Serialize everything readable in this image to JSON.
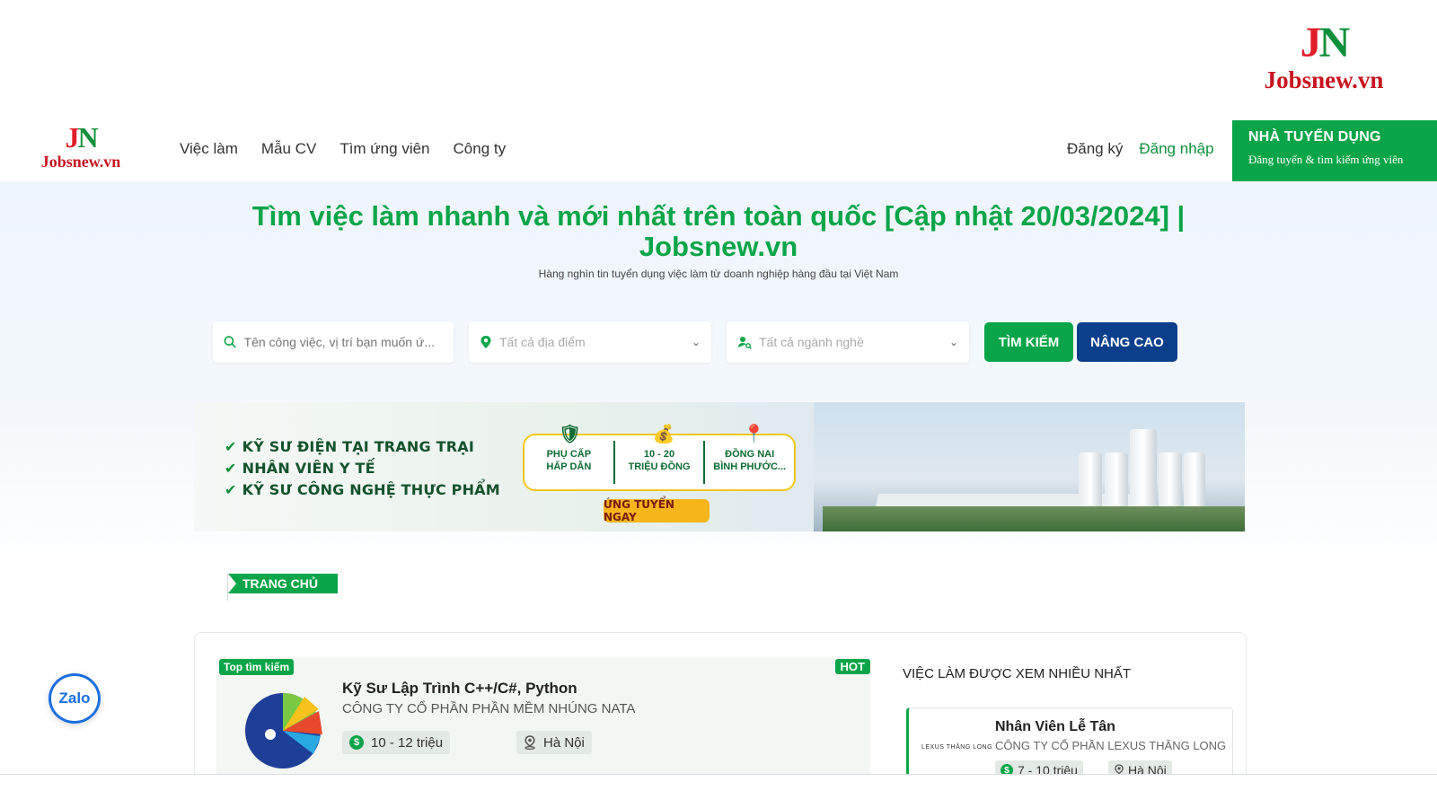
{
  "brand": {
    "mark_j": "J",
    "mark_n": "N",
    "name": "Jobsnew.vn"
  },
  "nav": {
    "items": [
      "Việc làm",
      "Mẫu CV",
      "Tìm ứng viên",
      "Công ty"
    ]
  },
  "auth": {
    "register": "Đăng ký",
    "login": "Đăng nhập"
  },
  "employer": {
    "title": "NHÀ TUYỂN DỤNG",
    "subtitle": "Đăng tuyển & tìm kiếm ứng viên"
  },
  "hero": {
    "title": "Tìm việc làm nhanh và mới nhất trên toàn quốc [Cập nhật 20/03/2024] | Jobsnew.vn",
    "subtitle": "Hàng nghìn tin tuyển dụng việc làm từ doanh nghiệp hàng đầu tại Việt Nam"
  },
  "search": {
    "keyword_placeholder": "Tên công việc, vị trí bạn muốn ứ...",
    "location_placeholder": "Tất cả địa điểm",
    "industry_placeholder": "Tất cả ngành nghề",
    "search_label": "TÌM KIẾM",
    "advanced_label": "NÂNG CAO"
  },
  "banner": {
    "items": [
      "KỸ SƯ ĐIỆN TẠI TRANG TRẠI",
      "NHÂN VIÊN Y TẾ",
      "KỸ SƯ CÔNG NGHỆ THỰC PHẨM"
    ],
    "perks": [
      {
        "l1": "PHỤ CẤP",
        "l2": "HẤP DẪN"
      },
      {
        "l1": "10 - 20",
        "l2": "TRIỆU ĐỒNG"
      },
      {
        "l1": "ĐỒNG NAI",
        "l2": "BÌNH PHƯỚC..."
      }
    ],
    "apply_label": "ỨNG TUYỂN NGAY"
  },
  "breadcrumb": {
    "label": "TRANG CHỦ"
  },
  "featured_job": {
    "badge": "Top tìm kiếm",
    "hot": "HOT",
    "title": "Kỹ Sư Lập Trình C++/C#, Python",
    "company": "CÔNG TY CỔ PHẦN PHẦN MỀM NHÚNG NATA",
    "salary": "10 - 12 triệu",
    "location": "Hà Nội"
  },
  "most_viewed": {
    "title": "VIỆC LÀM ĐƯỢC XEM NHIỀU NHẤT",
    "job": {
      "logo_text": "LEXUS THĂNG LONG",
      "title": "Nhân Viên Lễ Tân",
      "company": "CÔNG TY CỔ PHẦN LEXUS THĂNG LONG",
      "salary": "7 - 10 triệu",
      "location": "Hà Nội"
    }
  },
  "zalo": {
    "label": "Zalo"
  },
  "colors": {
    "green": "#0aa548",
    "navy": "#0b3f8c",
    "red": "#c8141f"
  }
}
